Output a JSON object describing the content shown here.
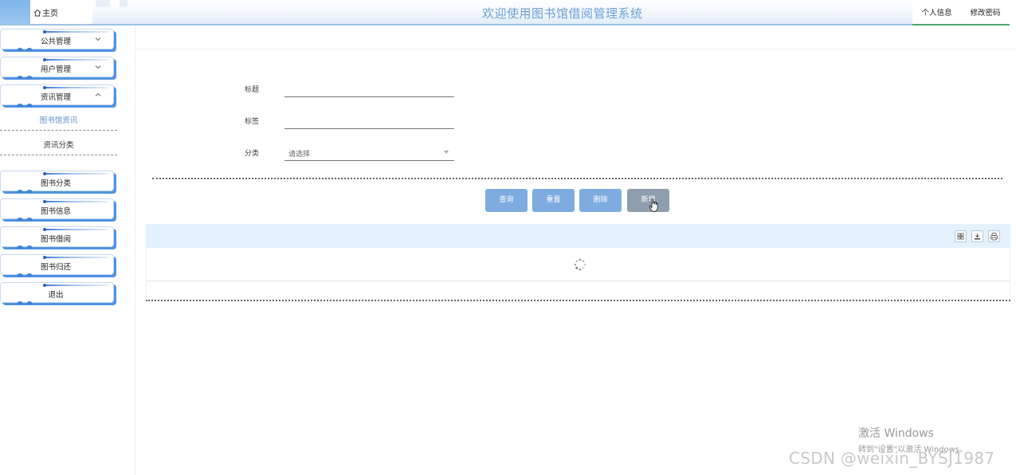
{
  "header": {
    "home_label": "主页",
    "title": "欢迎使用图书馆借阅管理系统",
    "user_links": [
      "个人信息",
      "修改密码"
    ]
  },
  "sidebar": {
    "menus": [
      {
        "label": "公共管理",
        "chevron": "down"
      },
      {
        "label": "用户管理",
        "chevron": "down"
      },
      {
        "label": "资讯管理",
        "chevron": "up"
      }
    ],
    "submenu": [
      {
        "label": "图书馆资讯",
        "active": true
      },
      {
        "label": "资讯分类",
        "active": false
      }
    ],
    "menus2": [
      {
        "label": "图书分类"
      },
      {
        "label": "图书信息"
      },
      {
        "label": "图书借阅"
      },
      {
        "label": "图书归还"
      },
      {
        "label": "退出"
      }
    ]
  },
  "search_form": {
    "fields": [
      {
        "label": "标题",
        "value": ""
      },
      {
        "label": "标签",
        "value": ""
      },
      {
        "label": "分类",
        "placeholder": "请选择"
      }
    ]
  },
  "actions": {
    "query": "查询",
    "reset": "重置",
    "delete": "删除",
    "add": "新增"
  },
  "table": {
    "tools": [
      "columns-icon",
      "export-icon",
      "print-icon"
    ],
    "loading": true
  },
  "watermarks": {
    "windows_line1": "激活 Windows",
    "windows_line2": "转到\"设置\"以激活 Windows。",
    "csdn": "CSDN @weixin_BYSJ1987"
  },
  "colors": {
    "accent_blue": "#7eabe0",
    "title_blue": "#6d9fd6",
    "menu_shadow": "#4f93e0",
    "active_submenu": "#5a8fd0",
    "add_button": "#8f9dae"
  }
}
